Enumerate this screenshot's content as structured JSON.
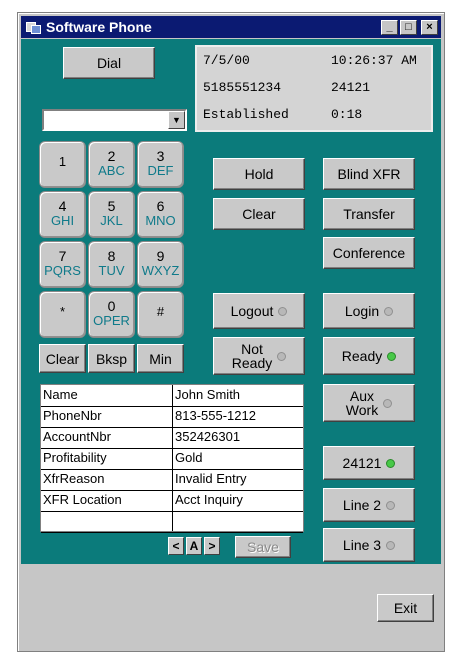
{
  "window": {
    "title": "Software Phone",
    "minimize": "_",
    "maximize": "□",
    "close": "×"
  },
  "dial_button": "Dial",
  "number_input": {
    "value": ""
  },
  "display": {
    "date": "7/5/00",
    "time": "10:26:37 AM",
    "number": "5185551234",
    "extension": "24121",
    "state": "Established",
    "duration": "0:18"
  },
  "keypad": [
    {
      "digit": "1",
      "letters": ""
    },
    {
      "digit": "2",
      "letters": "ABC"
    },
    {
      "digit": "3",
      "letters": "DEF"
    },
    {
      "digit": "4",
      "letters": "GHI"
    },
    {
      "digit": "5",
      "letters": "JKL"
    },
    {
      "digit": "6",
      "letters": "MNO"
    },
    {
      "digit": "7",
      "letters": "PQRS"
    },
    {
      "digit": "8",
      "letters": "TUV"
    },
    {
      "digit": "9",
      "letters": "WXYZ"
    },
    {
      "digit": "*",
      "letters": ""
    },
    {
      "digit": "0",
      "letters": "OPER"
    },
    {
      "digit": "#",
      "letters": ""
    }
  ],
  "keypad_actions": {
    "clear": "Clear",
    "backspace": "Bksp",
    "min": "Min"
  },
  "call_controls": {
    "hold": "Hold",
    "blind_xfr": "Blind XFR",
    "clear": "Clear",
    "transfer": "Transfer",
    "conference": "Conference"
  },
  "agent_controls": {
    "logout": "Logout",
    "login": "Login",
    "not_ready_1": "Not",
    "not_ready_2": "Ready",
    "ready": "Ready",
    "aux_work_1": "Aux",
    "aux_work_2": "Work"
  },
  "lines": {
    "line1": "24121",
    "line2": "Line 2",
    "line3": "Line 3"
  },
  "indicator_colors": {
    "on": "#48c848",
    "off": "#b8b8b8"
  },
  "call_data": [
    {
      "field": "Name",
      "value": "John Smith"
    },
    {
      "field": "PhoneNbr",
      "value": "813-555-1212"
    },
    {
      "field": "AccountNbr",
      "value": "352426301"
    },
    {
      "field": "Profitability",
      "value": "Gold"
    },
    {
      "field": "XfrReason",
      "value": "Invalid Entry"
    },
    {
      "field": "XFR Location",
      "value": "Acct Inquiry"
    },
    {
      "field": "",
      "value": ""
    }
  ],
  "record_nav": {
    "prev": "<",
    "current": "A",
    "next": ">",
    "save": "Save"
  },
  "exit_button": "Exit"
}
